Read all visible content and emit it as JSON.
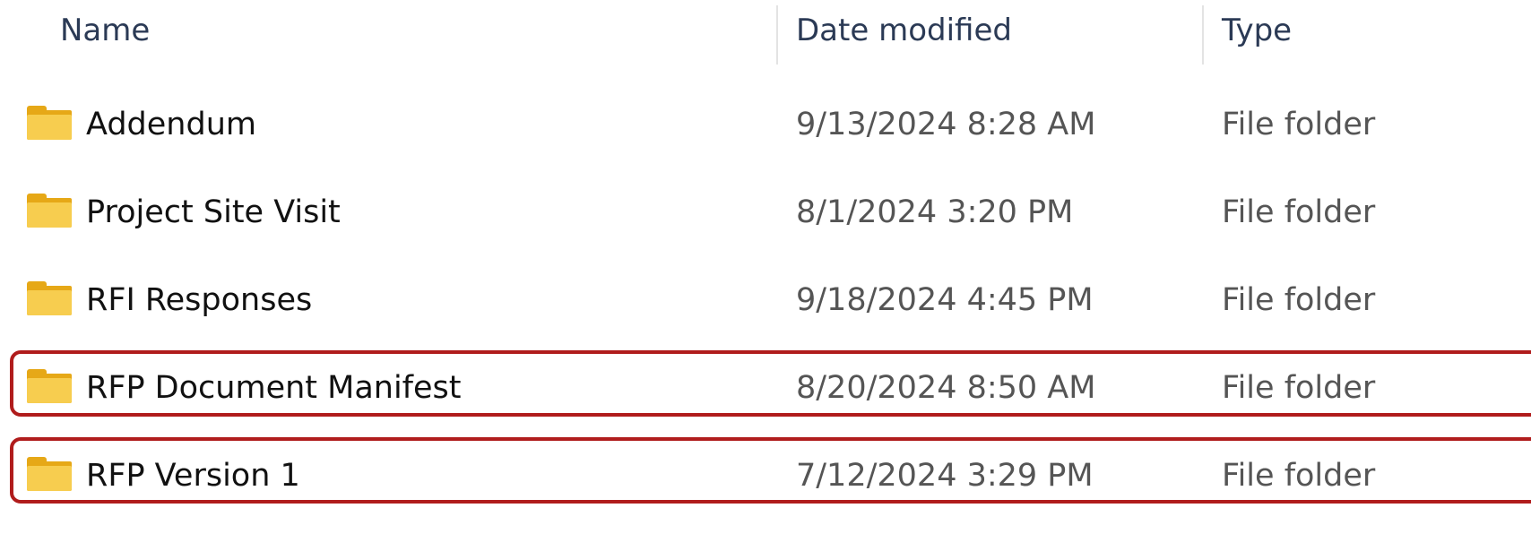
{
  "columns": {
    "name": "Name",
    "date_modified": "Date modified",
    "type": "Type"
  },
  "rows": [
    {
      "name": "Addendum",
      "date": "9/13/2024 8:28 AM",
      "type": "File folder",
      "icon": "folder-icon"
    },
    {
      "name": "Project Site Visit",
      "date": "8/1/2024 3:20 PM",
      "type": "File folder",
      "icon": "folder-icon"
    },
    {
      "name": "RFI Responses",
      "date": "9/18/2024 4:45 PM",
      "type": "File folder",
      "icon": "folder-icon"
    },
    {
      "name": "RFP Document Manifest",
      "date": "8/20/2024 8:50 AM",
      "type": "File folder",
      "icon": "folder-icon"
    },
    {
      "name": "RFP Version 1",
      "date": "7/12/2024 3:29 PM",
      "type": "File folder",
      "icon": "folder-icon"
    }
  ],
  "colors": {
    "folder_front": "#f7cd4f",
    "folder_back": "#e6a817",
    "highlight_border": "#b01c1c",
    "header_text": "#2b3a55"
  }
}
